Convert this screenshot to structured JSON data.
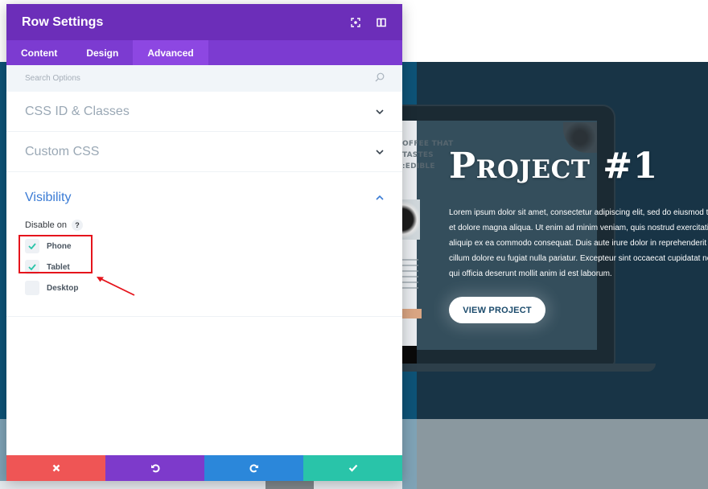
{
  "modal": {
    "title": "Row Settings",
    "header_icons": [
      "fullscreen-icon",
      "split-view-icon"
    ],
    "tabs": [
      {
        "label": "Content",
        "active": false
      },
      {
        "label": "Design",
        "active": false
      },
      {
        "label": "Advanced",
        "active": true
      }
    ],
    "search": {
      "placeholder": "Search Options",
      "value": ""
    },
    "sections": [
      {
        "title": "CSS ID & Classes",
        "expanded": false
      },
      {
        "title": "Custom CSS",
        "expanded": false
      },
      {
        "title": "Visibility",
        "expanded": true
      }
    ],
    "visibility": {
      "disable_on_label": "Disable on",
      "help_glyph": "?",
      "options": [
        {
          "label": "Phone",
          "checked": true
        },
        {
          "label": "Tablet",
          "checked": true
        },
        {
          "label": "Desktop",
          "checked": false
        }
      ]
    },
    "footer": {
      "buttons": [
        {
          "name": "cancel",
          "icon": "close-icon",
          "color": "#ef5555"
        },
        {
          "name": "undo",
          "icon": "undo-icon",
          "color": "#7d3acb"
        },
        {
          "name": "redo",
          "icon": "redo-icon",
          "color": "#2b87da"
        },
        {
          "name": "save",
          "icon": "check-icon",
          "color": "#29c4a9"
        }
      ]
    }
  },
  "colors": {
    "header": "#6c2eb9",
    "tabs": "#7c3bd1",
    "active_tab": "#8d47e2",
    "accent_blue": "#3a7bd5",
    "checkmark": "#29c4a9",
    "annotation_red": "#e5141c",
    "hero_bg": "#183446"
  },
  "page": {
    "mockup_text": [
      "OFFEE THAT TASTES",
      ":EDIBLE"
    ],
    "project_title": "Project #1",
    "project_body": [
      "Lorem ipsum dolor sit amet, consectetur adipiscing elit, sed do eiusmod te",
      "et dolore magna aliqua. Ut enim ad minim veniam, quis nostrud exercitatio",
      "aliquip ex ea commodo consequat. Duis aute irure dolor in reprehenderit i",
      "cillum dolore eu fugiat nulla pariatur. Excepteur sint occaecat cupidatat no",
      "qui officia deserunt mollit anim id est laborum."
    ],
    "cta_label": "VIEW PROJECT"
  }
}
